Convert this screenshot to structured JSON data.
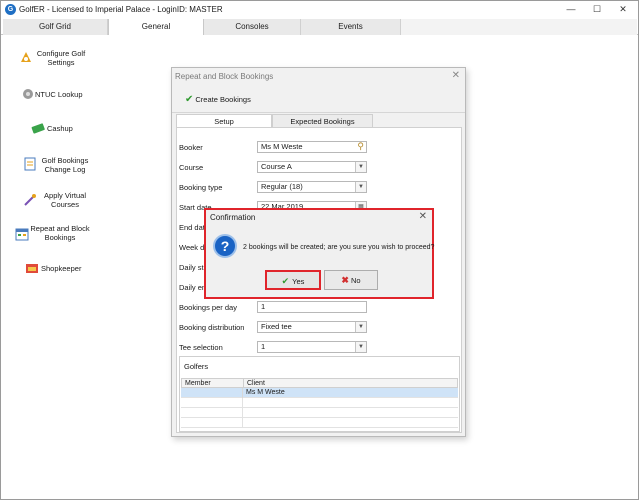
{
  "window": {
    "title": "GolfER - Licensed to Imperial Palace - LoginID: MASTER",
    "minimize": "—",
    "maximize": "☐",
    "close": "✕"
  },
  "tabs": [
    "Golf Grid",
    "General",
    "Consoles",
    "Events"
  ],
  "sidebar": {
    "items": [
      {
        "label_line1": "Configure Golf",
        "label_line2": "Settings"
      },
      {
        "label_line1": "NTUC Lookup",
        "label_line2": ""
      },
      {
        "label_line1": "Cashup",
        "label_line2": ""
      },
      {
        "label_line1": "Golf Bookings",
        "label_line2": "Change Log"
      },
      {
        "label_line1": "Apply Virtual",
        "label_line2": "Courses"
      },
      {
        "label_line1": "Repeat and Block",
        "label_line2": "Bookings"
      },
      {
        "label_line1": "Shopkeeper",
        "label_line2": ""
      }
    ]
  },
  "modal": {
    "title": "Repeat and Block Bookings",
    "close": "✕",
    "create_button": "Create Bookings",
    "subtabs": [
      "Setup",
      "Expected Bookings"
    ],
    "fields": {
      "booker": {
        "label": "Booker",
        "value": "Ms M Weste"
      },
      "course": {
        "label": "Course",
        "value": "Course A"
      },
      "booking_type": {
        "label": "Booking type",
        "value": "Regular (18)"
      },
      "start_date": {
        "label": "Start date",
        "value": "22 Mar 2019"
      },
      "end_date": {
        "label": "End date",
        "value": ""
      },
      "week_days": {
        "label": "Week da",
        "value": ""
      },
      "daily_start": {
        "label": "Daily sta",
        "value": ""
      },
      "daily_end": {
        "label": "Daily end",
        "value": ""
      },
      "bookings_per_day": {
        "label": "Bookings per day",
        "value": "1"
      },
      "booking_distribution": {
        "label": "Booking distribution",
        "value": "Fixed tee"
      },
      "tee_selection": {
        "label": "Tee selection",
        "value": "1"
      }
    },
    "golfers": {
      "title": "Golfers",
      "columns": [
        "Member",
        "Client"
      ],
      "rows": [
        {
          "member": "",
          "client": "Ms M Weste"
        }
      ]
    }
  },
  "confirm": {
    "title": "Confirmation",
    "close": "✕",
    "message": "2 bookings will be created; are you sure you wish to proceed?",
    "yes_label": "Yes",
    "no_label": "No"
  },
  "colors": {
    "highlight": "#e0242b",
    "selection": "#cfe3f7",
    "check": "#2f9a2f"
  }
}
